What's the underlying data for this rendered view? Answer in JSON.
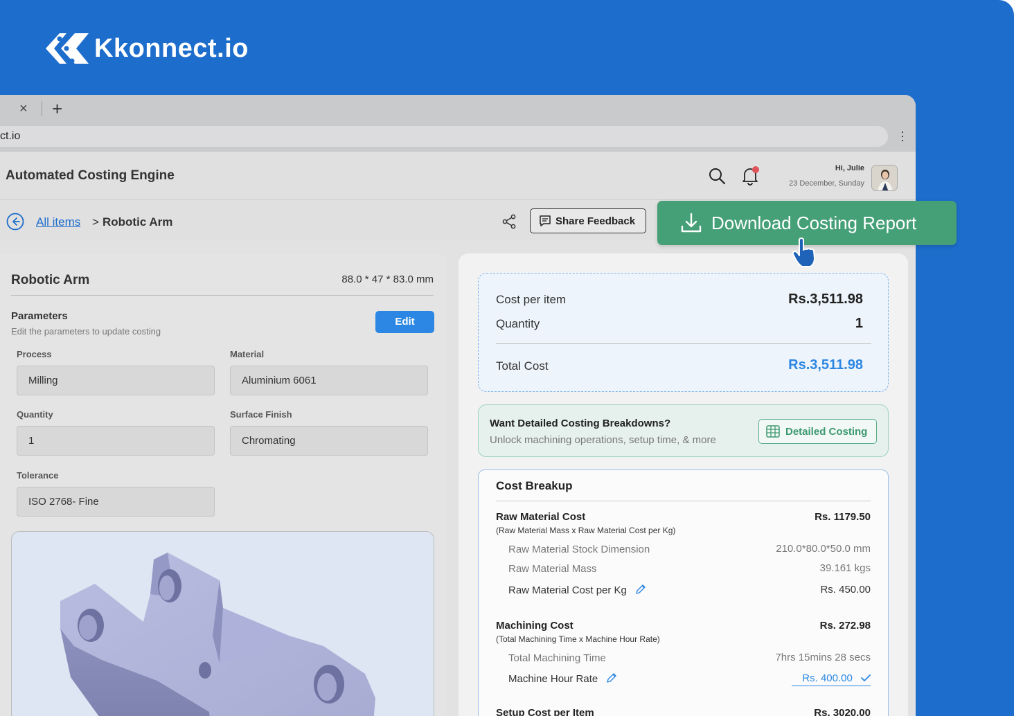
{
  "brand": {
    "name": "Kkonnect.io"
  },
  "browser": {
    "address": "ct.io",
    "tab_close": "×",
    "tab_new": "+"
  },
  "app": {
    "title": "Automated Costing Engine",
    "user_greeting": "Hi, Julie",
    "date": "23 December, Sunday"
  },
  "breadcrumb": {
    "link": "All items",
    "separator": ">",
    "current": "Robotic Arm"
  },
  "actions": {
    "share_feedback": "Share Feedback",
    "download": "Download Costing Report"
  },
  "item": {
    "name": "Robotic Arm",
    "dimensions": "88.0 * 47 * 83.0 mm",
    "parameters_title": "Parameters",
    "parameters_sub": "Edit the parameters to update costing",
    "edit_label": "Edit",
    "fields": {
      "process_label": "Process",
      "process": "Milling",
      "material_label": "Material",
      "material": "Aluminium 6061",
      "quantity_label": "Quantity",
      "quantity": "1",
      "finish_label": "Surface Finish",
      "finish": "Chromating",
      "tolerance_label": "Tolerance",
      "tolerance": "ISO 2768- Fine"
    }
  },
  "summary": {
    "cost_per_item_label": "Cost per item",
    "cost_per_item": "Rs.3,511.98",
    "quantity_label": "Quantity",
    "quantity": "1",
    "total_label": "Total Cost",
    "total": "Rs.3,511.98"
  },
  "promo": {
    "title": "Want Detailed Costing Breakdowns?",
    "sub": "Unlock machining operations, setup time, & more",
    "button": "Detailed Costing"
  },
  "breakup": {
    "title": "Cost Breakup",
    "raw": {
      "label": "Raw Material Cost",
      "formula": "(Raw Material Mass x Raw Material Cost per Kg)",
      "value": "Rs. 1179.50",
      "stock_label": "Raw Material Stock Dimension",
      "stock": "210.0*80.0*50.0 mm",
      "mass_label": "Raw Material Mass",
      "mass": "39.161 kgs",
      "cost_kg_label": "Raw Material Cost per Kg",
      "cost_kg": "Rs. 450.00"
    },
    "machining": {
      "label": "Machining Cost",
      "formula": "(Total Machining Time x Machine Hour Rate)",
      "value": "Rs. 272.98",
      "time_label": "Total Machining Time",
      "time": "7hrs 15mins 28 secs",
      "rate_label": "Machine Hour Rate",
      "rate": "Rs. 400.00"
    },
    "setup": {
      "label": "Setup Cost per Item",
      "value": "Rs. 3020.00"
    }
  },
  "colors": {
    "brand_blue": "#1d6dcc",
    "accent_blue": "#2b87e3",
    "green": "#45a077"
  }
}
